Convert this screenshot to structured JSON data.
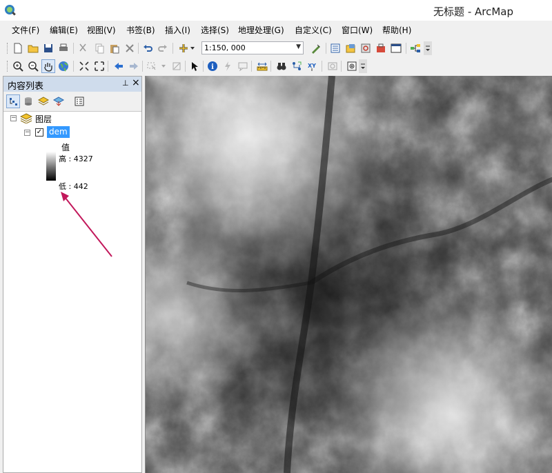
{
  "window": {
    "title": "无标题 - ArcMap"
  },
  "menu": [
    "文件(F)",
    "编辑(E)",
    "视图(V)",
    "书签(B)",
    "插入(I)",
    "选择(S)",
    "地理处理(G)",
    "自定义(C)",
    "窗口(W)",
    "帮助(H)"
  ],
  "toolbar": {
    "scale_value": "1:150, 000"
  },
  "toc": {
    "title": "内容列表",
    "layers_group": "图层",
    "layer": {
      "name": "dem",
      "checked": true
    },
    "legend": {
      "field": "值",
      "high": "高 : 4327",
      "low": "低 : 442"
    }
  },
  "colors": {
    "annotation_arrow": "#c2185b",
    "selection": "#3399ff",
    "toc_header": "#cfdcec"
  },
  "icons": [
    "new-icon",
    "open-icon",
    "save-icon",
    "print-icon",
    "cut-icon",
    "copy-icon",
    "paste-icon",
    "delete-icon",
    "undo-icon",
    "redo-icon",
    "add-data-icon",
    "zoom-in-icon",
    "zoom-out-icon",
    "pan-icon",
    "globe-icon",
    "select-icon",
    "identify-icon",
    "find-icon",
    "xy-icon"
  ]
}
